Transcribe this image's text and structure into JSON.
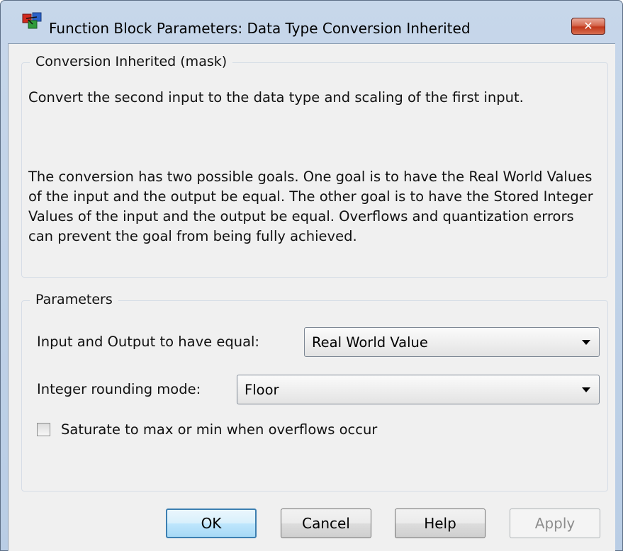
{
  "window": {
    "title": "Function Block Parameters: Data Type Conversion Inherited",
    "close_label": "✕"
  },
  "description_group": {
    "label": "Conversion Inherited (mask)",
    "paragraph1": "Convert the second input to the data type and scaling of the first input.",
    "paragraph2": "The conversion has two possible goals.  One goal is to have the Real World Values of the input and the output be equal.  The other goal is to have the Stored Integer Values of the input and the output be equal.  Overflows and quantization errors can prevent the goal from being fully achieved."
  },
  "parameters_group": {
    "label": "Parameters",
    "equal_label": "Input and Output to have equal:",
    "equal_value": "Real World Value",
    "rounding_label": "Integer rounding mode:",
    "rounding_value": "Floor",
    "saturate_label": "Saturate to max or min when overflows occur",
    "saturate_checked": false
  },
  "buttons": {
    "ok": "OK",
    "cancel": "Cancel",
    "help": "Help",
    "apply": "Apply"
  },
  "colors": {
    "title_bar": "#b9cde5",
    "close_button": "#c2391c",
    "client_background": "#f0f0f0",
    "default_button_border": "#3c7fb1"
  },
  "icons": {
    "app": "simulink-block-icon",
    "close": "close-icon",
    "dropdown": "chevron-down-icon"
  }
}
